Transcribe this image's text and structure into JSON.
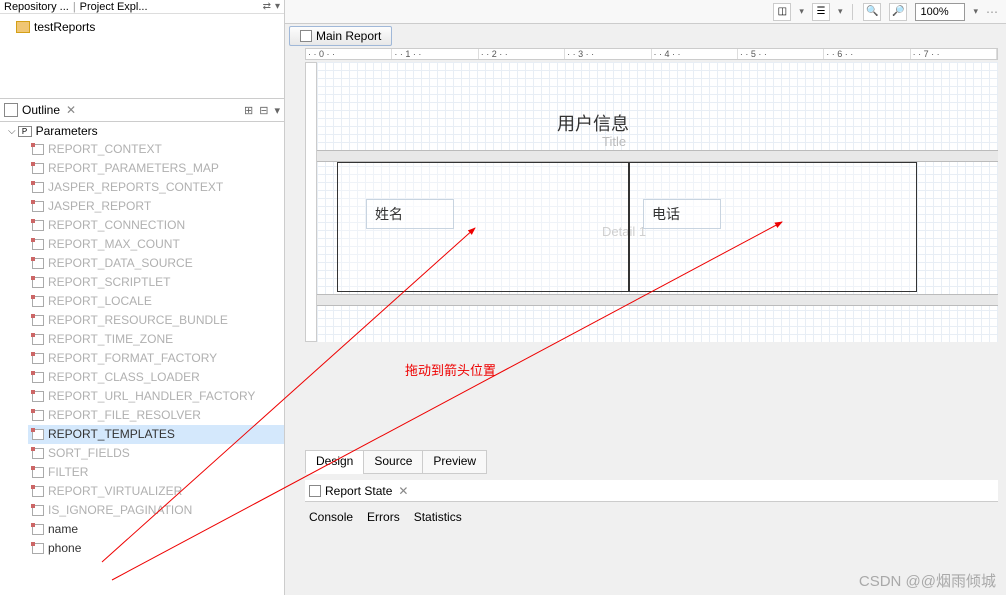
{
  "topTab": {
    "repositoryLabel": "Repository ...",
    "projectLabel": "Project Expl..."
  },
  "tree": {
    "testReports": "testReports"
  },
  "outline": {
    "label": "Outline"
  },
  "parameters": {
    "rootLabel": "Parameters",
    "items": [
      "REPORT_CONTEXT",
      "REPORT_PARAMETERS_MAP",
      "JASPER_REPORTS_CONTEXT",
      "JASPER_REPORT",
      "REPORT_CONNECTION",
      "REPORT_MAX_COUNT",
      "REPORT_DATA_SOURCE",
      "REPORT_SCRIPTLET",
      "REPORT_LOCALE",
      "REPORT_RESOURCE_BUNDLE",
      "REPORT_TIME_ZONE",
      "REPORT_FORMAT_FACTORY",
      "REPORT_CLASS_LOADER",
      "REPORT_URL_HANDLER_FACTORY",
      "REPORT_FILE_RESOLVER",
      "REPORT_TEMPLATES",
      "SORT_FIELDS",
      "FILTER",
      "REPORT_VIRTUALIZER",
      "IS_IGNORE_PAGINATION",
      "name",
      "phone"
    ],
    "selectedIndex": 15
  },
  "editor": {
    "mainReportLabel": "Main Report",
    "zoomValue": "100%",
    "rulerTicks": [
      "0",
      "1",
      "2",
      "3",
      "4",
      "5",
      "6",
      "7"
    ]
  },
  "report": {
    "title": "用户信息",
    "titleGhost": "Title",
    "detailGhost": "Detail 1",
    "cell1": "姓名",
    "cell2": "电话"
  },
  "annotation": "拖动到箭头位置",
  "tabs": {
    "design": "Design",
    "source": "Source",
    "preview": "Preview"
  },
  "reportState": {
    "label": "Report State"
  },
  "consoleTabs": {
    "console": "Console",
    "errors": "Errors",
    "statistics": "Statistics"
  },
  "watermark": "CSDN @@烟雨倾城"
}
